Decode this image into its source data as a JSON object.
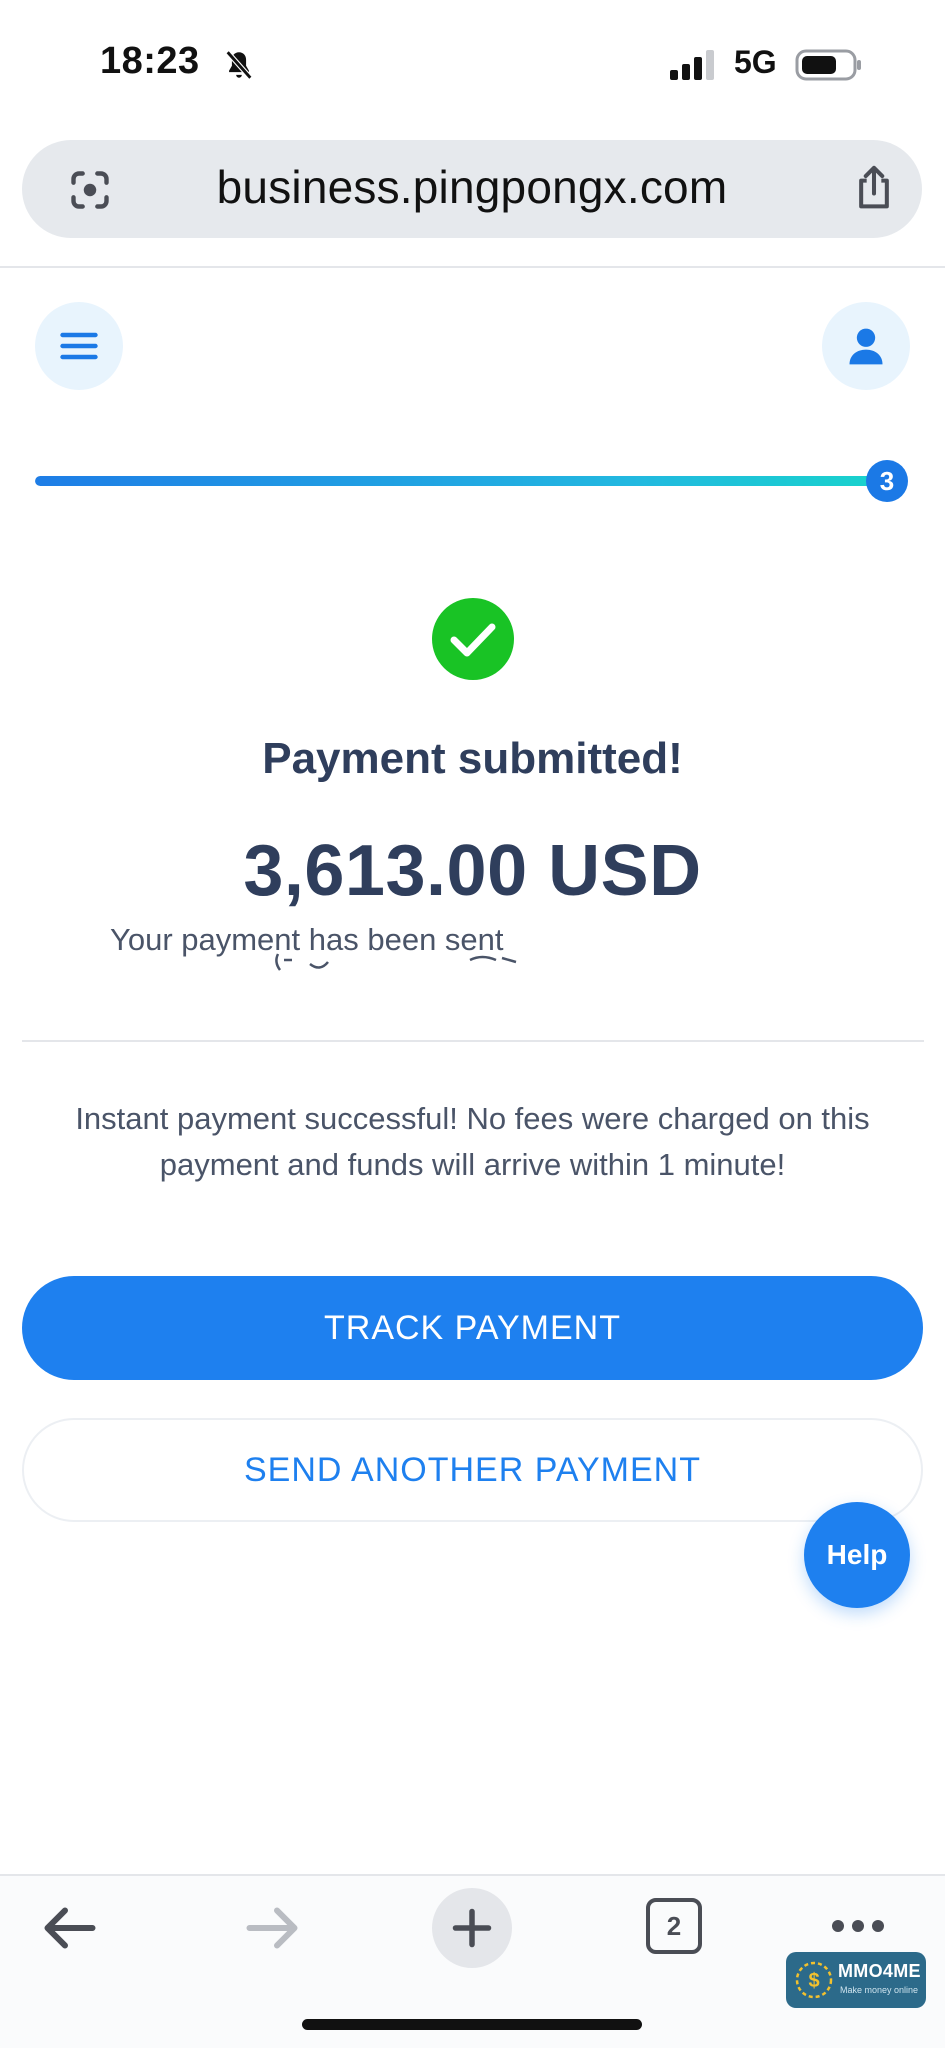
{
  "status_bar": {
    "time": "18:23",
    "network": "5G"
  },
  "browser": {
    "url": "business.pingpongx.com",
    "tab_count": "2"
  },
  "progress": {
    "step": "3",
    "fraction": 1.0
  },
  "success": {
    "title": "Payment submitted!",
    "amount": "3,613.00 USD",
    "sent_text": "Your payment has been sent"
  },
  "info": {
    "message": "Instant payment successful! No fees were charged on this payment and funds will arrive within 1 minute!"
  },
  "buttons": {
    "track_label": "TRACK PAYMENT",
    "another_label": "SEND ANOTHER PAYMENT",
    "help_label": "Help"
  },
  "watermark": {
    "title": "MMO4ME",
    "subtitle": "Make money online"
  },
  "colors": {
    "accent": "#1e80ef",
    "success": "#19c325",
    "text_dark": "#2f3e5c",
    "text_muted": "#4a5468"
  },
  "icons": {
    "status": [
      "bell-slash-icon",
      "signal-icon",
      "battery-icon"
    ],
    "browser": [
      "scan-icon",
      "share-icon"
    ],
    "header": [
      "menu-icon",
      "profile-icon"
    ],
    "toolbar": [
      "back-arrow-icon",
      "forward-arrow-icon",
      "plus-icon",
      "tabs-icon",
      "more-icon"
    ]
  }
}
